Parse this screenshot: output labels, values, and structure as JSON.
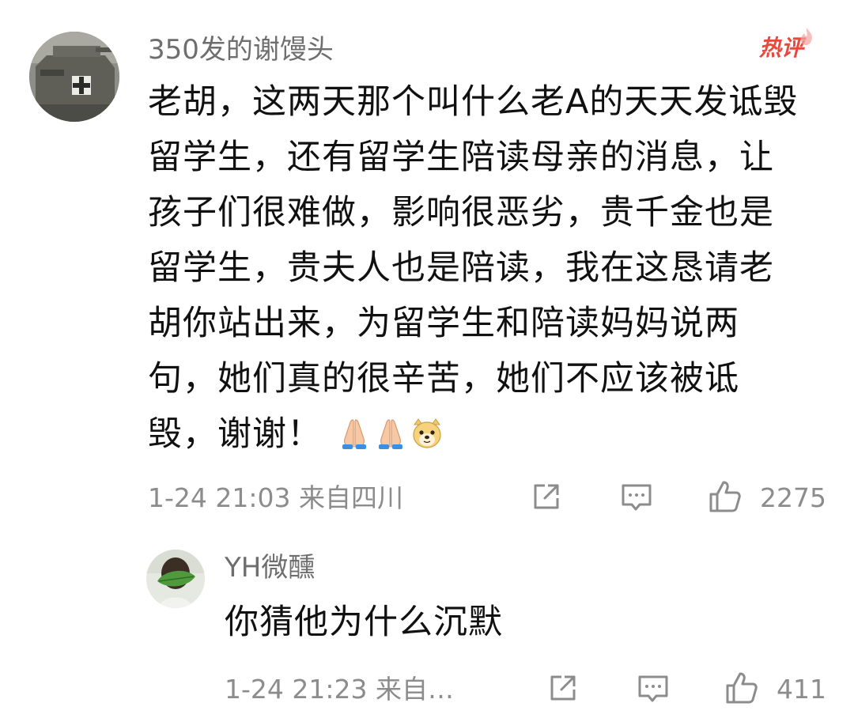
{
  "main_comment": {
    "username": "350发的谢馒头",
    "badge": "热评",
    "text": "老胡，这两天那个叫什么老A的天天发诋毁留学生，还有留学生陪读母亲的消息，让孩子们很难做，影响很恶劣，贵千金也是留学生，贵夫人也是陪读，我在这恳请老胡你站出来，为留学生和陪读妈妈说两句，她们真的很辛苦，她们不应该被诋毁，谢谢！",
    "emojis": [
      "folded-hands",
      "folded-hands",
      "doge"
    ],
    "timestamp": "1-24 21:03",
    "location": "来自四川",
    "like_count": "2275"
  },
  "reply": {
    "username": "YH微醺",
    "text": "你猜他为什么沉默",
    "timestamp": "1-24 21:23",
    "location": "来自…",
    "like_count": "411"
  },
  "icons": {
    "share": "share-icon",
    "comment": "comment-icon",
    "like": "thumbs-up-icon"
  },
  "colors": {
    "hot_badge": "#e8493c",
    "meta_text": "#8c8c8c",
    "username": "#6e6e6e",
    "body_text": "#111111"
  }
}
